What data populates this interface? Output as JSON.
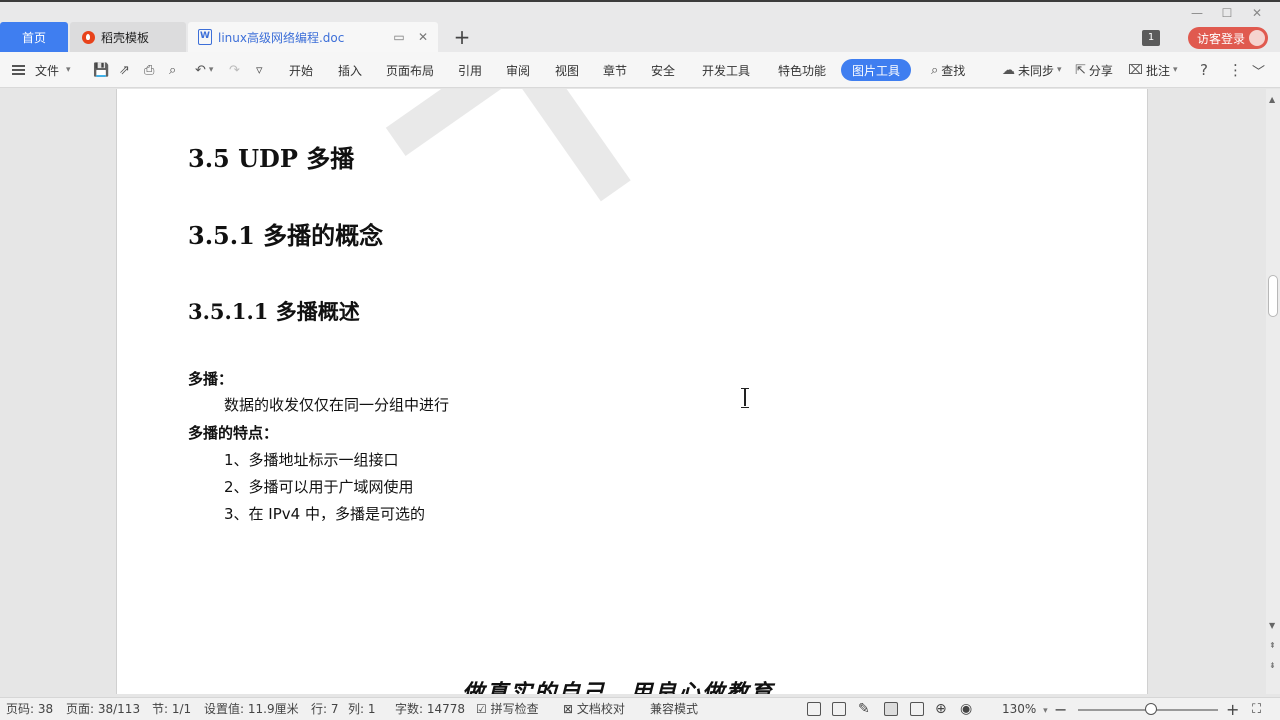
{
  "tabs": {
    "home": "首页",
    "templates": "稻壳模板",
    "document": "linux高级网络编程.doc"
  },
  "window": {
    "badge_count": "1",
    "visitor_login": "访客登录"
  },
  "ribbon": {
    "file": "文件",
    "tabs": [
      "开始",
      "插入",
      "页面布局",
      "引用",
      "审阅",
      "视图",
      "章节",
      "安全",
      "开发工具",
      "特色功能"
    ],
    "active_tab": "图片工具",
    "search": "查找",
    "sync": "未同步",
    "share": "分享",
    "comment": "批注"
  },
  "document": {
    "watermark": "千锋",
    "heading_1": "3.5 UDP 多播",
    "heading_2": "3.5.1  多播的概念",
    "heading_3": "3.5.1.1  多播概述",
    "label_multicast": "多播：",
    "desc_multicast": "数据的收发仅仅在同一分组中进行",
    "label_features": "多播的特点：",
    "feature_1": "1、多播地址标示一组接口",
    "feature_2": "2、多播可以用于广域网使用",
    "feature_3": "3、在 IPv4 中，多播是可选的",
    "footer_slogan": "做真实的自己，用良心做教育"
  },
  "statusbar": {
    "page_code": "页码: 38",
    "page": "页面: 38/113",
    "section": "节: 1/1",
    "setting": "设置值: 11.9厘米",
    "row": "行: 7",
    "col": "列: 1",
    "word_count": "字数: 14778",
    "spell_check": "拼写检查",
    "doc_proof": "文档校对",
    "compat_mode": "兼容模式",
    "zoom": "130%"
  }
}
